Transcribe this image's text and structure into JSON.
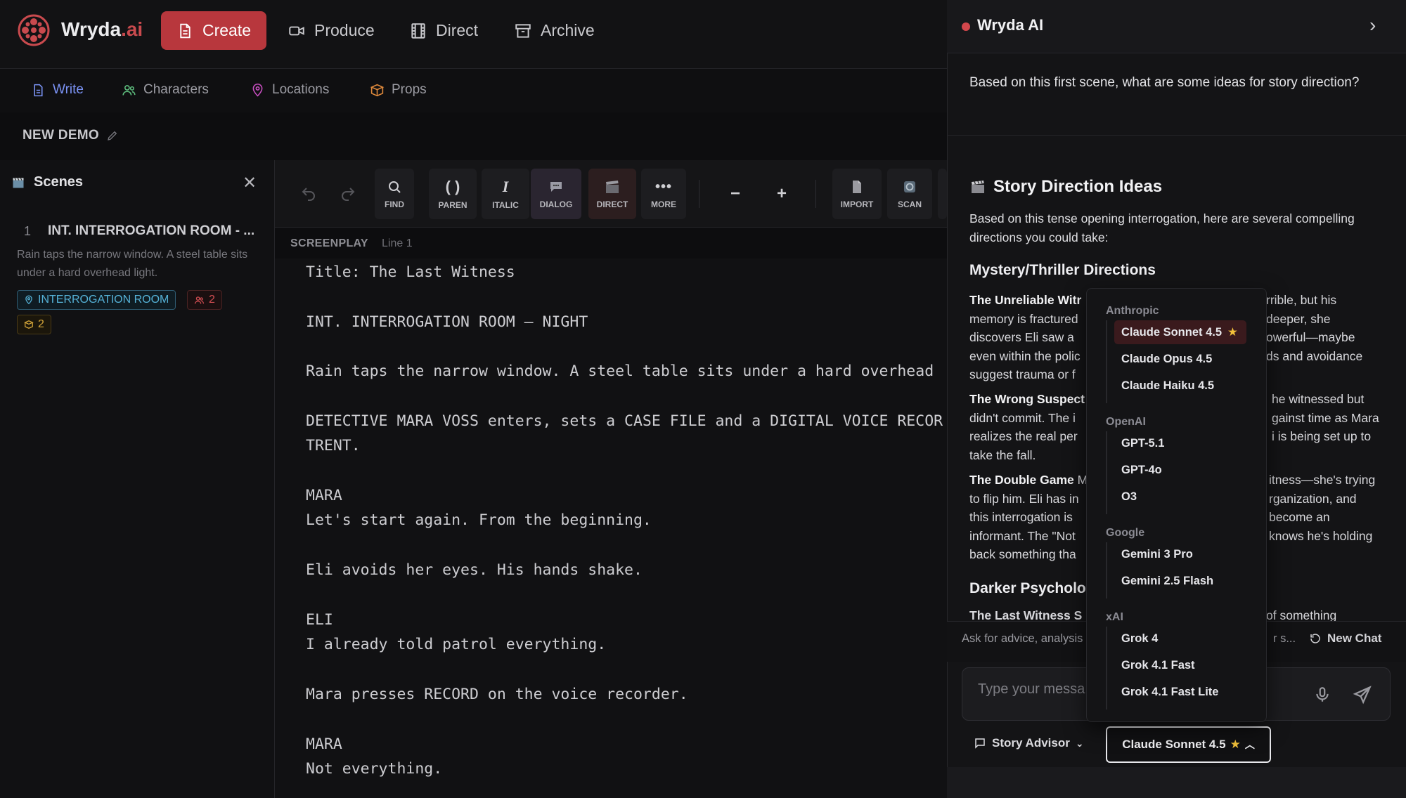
{
  "app": {
    "name": "Wryda",
    "tld": ".ai"
  },
  "topnav": [
    {
      "label": "Create",
      "icon": "document-icon",
      "active": true
    },
    {
      "label": "Produce",
      "icon": "video-camera-icon",
      "active": false
    },
    {
      "label": "Direct",
      "icon": "film-icon",
      "active": false
    },
    {
      "label": "Archive",
      "icon": "archive-box-icon",
      "active": false
    }
  ],
  "subnav": [
    {
      "label": "Write",
      "icon": "file-icon",
      "active": true
    },
    {
      "label": "Characters",
      "icon": "users-icon",
      "active": false
    },
    {
      "label": "Locations",
      "icon": "map-pin-icon",
      "active": false
    },
    {
      "label": "Props",
      "icon": "box-icon",
      "active": false
    }
  ],
  "project": {
    "title": "NEW DEMO"
  },
  "scenes_panel": {
    "title": "Scenes",
    "scene": {
      "number": "1",
      "heading": "INT. INTERROGATION ROOM - ...",
      "description": "Rain taps the narrow window. A steel table sits under a hard overhead light.",
      "location": "INTERROGATION ROOM",
      "characters": "2",
      "props": "2"
    }
  },
  "toolbar": {
    "find": "FIND",
    "paren": "PAREN",
    "italic": "ITALIC",
    "dialog": "DIALOG",
    "direct": "DIRECT",
    "more": "MORE",
    "minus": "−",
    "plus": "+",
    "import": "IMPORT",
    "scan": "SCAN"
  },
  "editor": {
    "mode": "SCREENPLAY",
    "line": "Line 1",
    "lines": [
      "Title: The Last Witness",
      "INT. INTERROGATION ROOM – NIGHT",
      "Rain taps the narrow window. A steel table sits under a hard overhead",
      "DETECTIVE MARA VOSS enters, sets a CASE FILE and a DIGITAL VOICE RECOR",
      "TRENT.",
      "MARA",
      "Let's start again. From the beginning.",
      "Eli avoids her eyes. His hands shake.",
      "ELI",
      "I already told patrol everything.",
      "Mara presses RECORD on the voice recorder.",
      "MARA",
      "Not everything."
    ]
  },
  "ai": {
    "title": "Wryda AI",
    "user_question": "Based on this first scene, what are some ideas for story direction?",
    "heading": "Story Direction Ideas",
    "intro": "Based on this tense opening interrogation, here are several compelling directions you could take:",
    "section1": "Mystery/Thriller Directions",
    "p1_bold": "The Unreliable Witr",
    "p1_left": "memory is fractured",
    "p1_l3": "discovers Eli saw a",
    "p1_l4": "even within the polic",
    "p1_l5": "suggest trauma or f",
    "p1_right1": "rrible, but his",
    "p1_right2": "deeper, she",
    "p1_right3": "owerful—maybe",
    "p1_right4": "ds and avoidance",
    "p2_bold": "The Wrong Suspect",
    "p2_l2": "didn't commit. The i",
    "p2_l3": "realizes the real per",
    "p2_l4": "take the fall.",
    "p2_right1": "he witnessed but",
    "p2_right2": "gainst time as Mara",
    "p2_right3": "i is being set up to",
    "p3_bold": "The Double Game",
    "p3_after": "M",
    "p3_l2": "to flip him. Eli has in",
    "p3_l3": "this interrogation is",
    "p3_l4": "informant. The \"Not",
    "p3_l5": "back something tha",
    "p3_right1": "itness—she's trying",
    "p3_right2": "rganization, and",
    "p3_right3": "become an",
    "p3_right4": "knows he's holding",
    "section2": "Darker Psycholo",
    "cut_bold": "The Last Witness S",
    "cut_right": "of something",
    "hint_left": "Ask for advice, analysis",
    "hint_right": "r s...",
    "new_chat": "New Chat",
    "input_placeholder": "Type your messa",
    "advisor": "Story Advisor",
    "selected_model": "Claude Sonnet 4.5"
  },
  "models": [
    {
      "provider": "Anthropic",
      "items": [
        "Claude Sonnet 4.5",
        "Claude Opus 4.5",
        "Claude Haiku 4.5"
      ]
    },
    {
      "provider": "OpenAI",
      "items": [
        "GPT-5.1",
        "GPT-4o",
        "O3"
      ]
    },
    {
      "provider": "Google",
      "items": [
        "Gemini 3 Pro",
        "Gemini 2.5 Flash"
      ]
    },
    {
      "provider": "xAI",
      "items": [
        "Grok 4",
        "Grok 4.1 Fast",
        "Grok 4.1 Fast Lite"
      ]
    }
  ],
  "colors": {
    "accent": "#b8373d",
    "link": "#7b93f5",
    "star": "#f3c23a"
  }
}
